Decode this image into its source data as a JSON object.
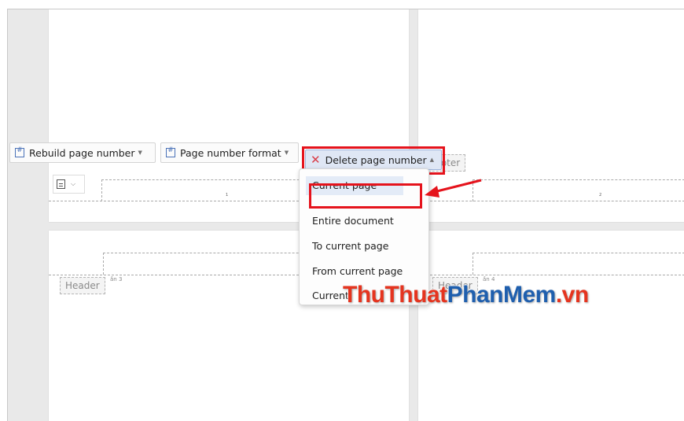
{
  "toolbar": {
    "rebuild_label": "Rebuild page number",
    "format_label": "Page number format",
    "delete_label": "Delete page number"
  },
  "menu": {
    "items": [
      "Current page",
      "Entire document",
      "To current page",
      "From current page",
      "Current"
    ]
  },
  "document": {
    "page1_number": "1",
    "page2_number": "2",
    "header_label": "Header",
    "footer_label": "Footer",
    "section3_label": "ần 3",
    "section4_label": "ần 4"
  },
  "watermark": {
    "part1": "ThuThuat",
    "part2": "PhanMem",
    "part3": ".vn"
  },
  "colors": {
    "highlight": "#e5131c",
    "delete_icon": "#d9404b"
  },
  "icons": {
    "rebuild": "hash-icon",
    "format": "hash-icon",
    "delete": "x-icon",
    "footer_options": "paragraph-lines-icon"
  }
}
